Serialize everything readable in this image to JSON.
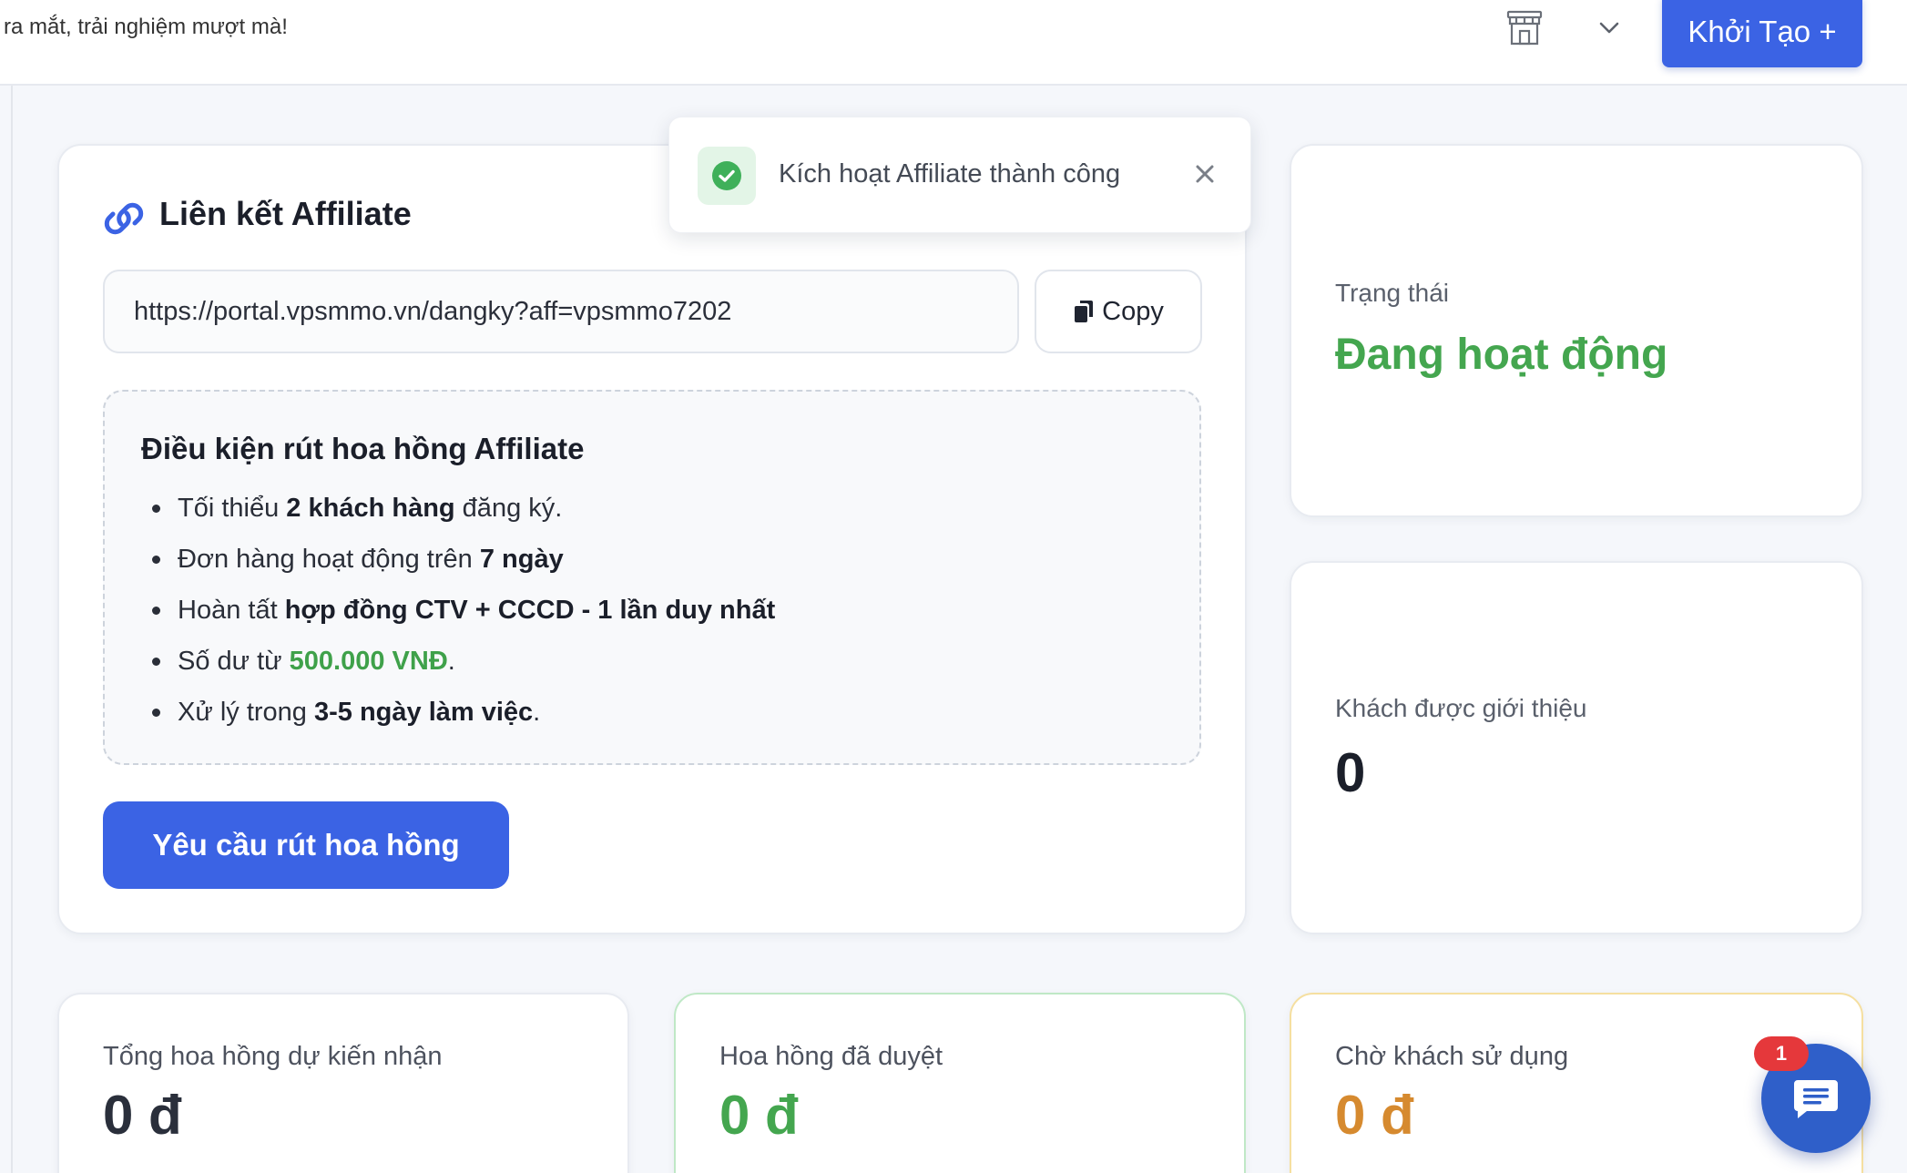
{
  "topbar": {
    "marquee": "ra mắt, trải nghiệm mượt mà!",
    "create_label": "Khởi Tạo +",
    "icons": {
      "cart": "shop-icon",
      "dropdown": "chevron-down-icon"
    }
  },
  "toast": {
    "message": "Kích hoạt Affiliate thành công",
    "icon": "check-circle-icon"
  },
  "affiliate": {
    "title": "Liên kết Affiliate",
    "link": "https://portal.vpsmmo.vn/dangky?aff=vpsmmo7202",
    "copy_label": "Copy",
    "conditions_title": "Điều kiện rút hoa hồng Affiliate",
    "conditions": [
      {
        "pre": "Tối thiểu ",
        "bold": "2 khách hàng",
        "post": " đăng ký."
      },
      {
        "pre": "Đơn hàng hoạt động trên ",
        "bold": "7 ngày",
        "post": ""
      },
      {
        "pre": "Hoàn tất ",
        "bold": "hợp đồng CTV + CCCD - 1 lần duy nhất",
        "post": ""
      },
      {
        "pre": "Số dư từ ",
        "bold": "500.000 VNĐ",
        "post": "."
      },
      {
        "pre": "Xử lý trong ",
        "bold": "3-5 ngày làm việc",
        "post": "."
      }
    ],
    "request_label": "Yêu cầu rút hoa hồng"
  },
  "status": {
    "label": "Trạng thái",
    "value": "Đang hoạt động"
  },
  "referrals": {
    "label": "Khách được giới thiệu",
    "value": "0"
  },
  "stats": [
    {
      "label": "Tổng hoa hồng dự kiến nhận",
      "value": "0 đ"
    },
    {
      "label": "Hoa hồng đã duyệt",
      "value": "0 đ"
    },
    {
      "label": "Chờ khách sử dụng",
      "value": "0 đ"
    }
  ],
  "chat": {
    "badge": "1"
  },
  "colors": {
    "primary": "#3b63e4",
    "success": "#44a64f",
    "warning": "#d68a2f"
  }
}
